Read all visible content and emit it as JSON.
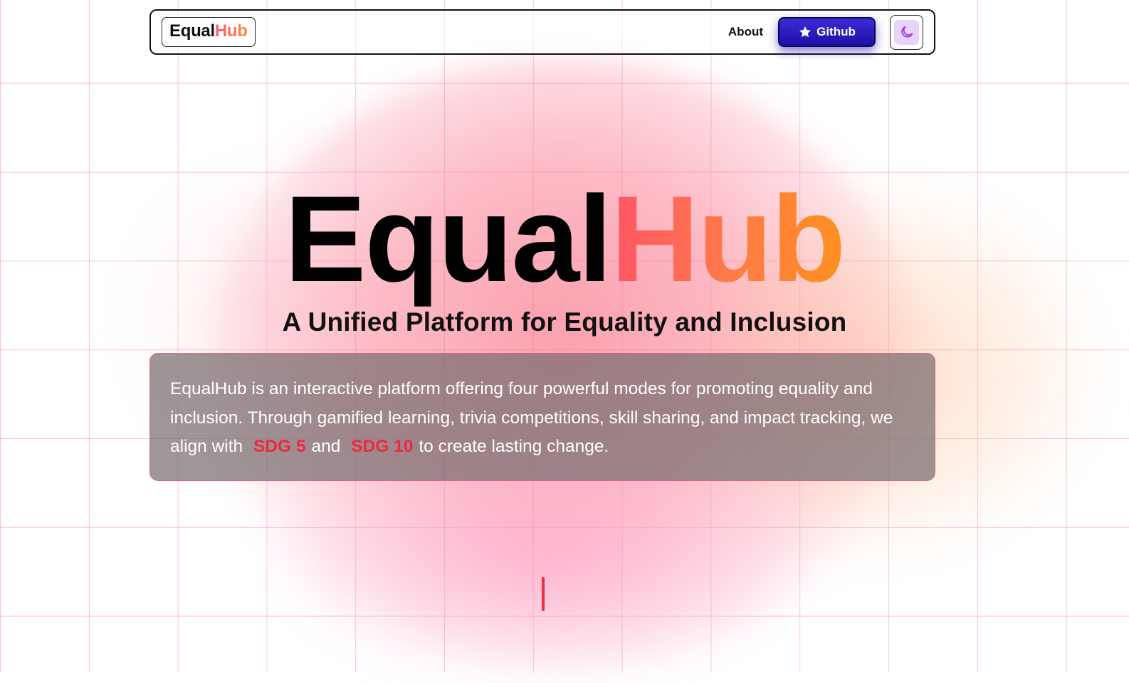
{
  "nav": {
    "logo_part1": "Equal",
    "logo_part2": "Hub",
    "about_label": "About",
    "github_label": "Github",
    "github_icon": "star-icon",
    "theme_icon": "moon-icon"
  },
  "hero": {
    "title_part1": "Equal",
    "title_part2": "Hub",
    "subtitle": "A Unified Platform for Equality and Inclusion"
  },
  "description": {
    "text_before": "EqualHub is an interactive platform offering four powerful modes for promoting equality and inclusion. Through gamified learning, trivia competitions, skill sharing, and impact tracking, we align with",
    "sdg_a": "SDG 5",
    "text_middle": "and",
    "sdg_b": "SDG 10",
    "text_after": "to create lasting change."
  },
  "colors": {
    "accent_red": "#f0283c",
    "hub_gradient_start": "#ff5566",
    "hub_gradient_end": "#ff9020",
    "github_button": "#2a1cc0",
    "grid_line": "#f48296"
  }
}
